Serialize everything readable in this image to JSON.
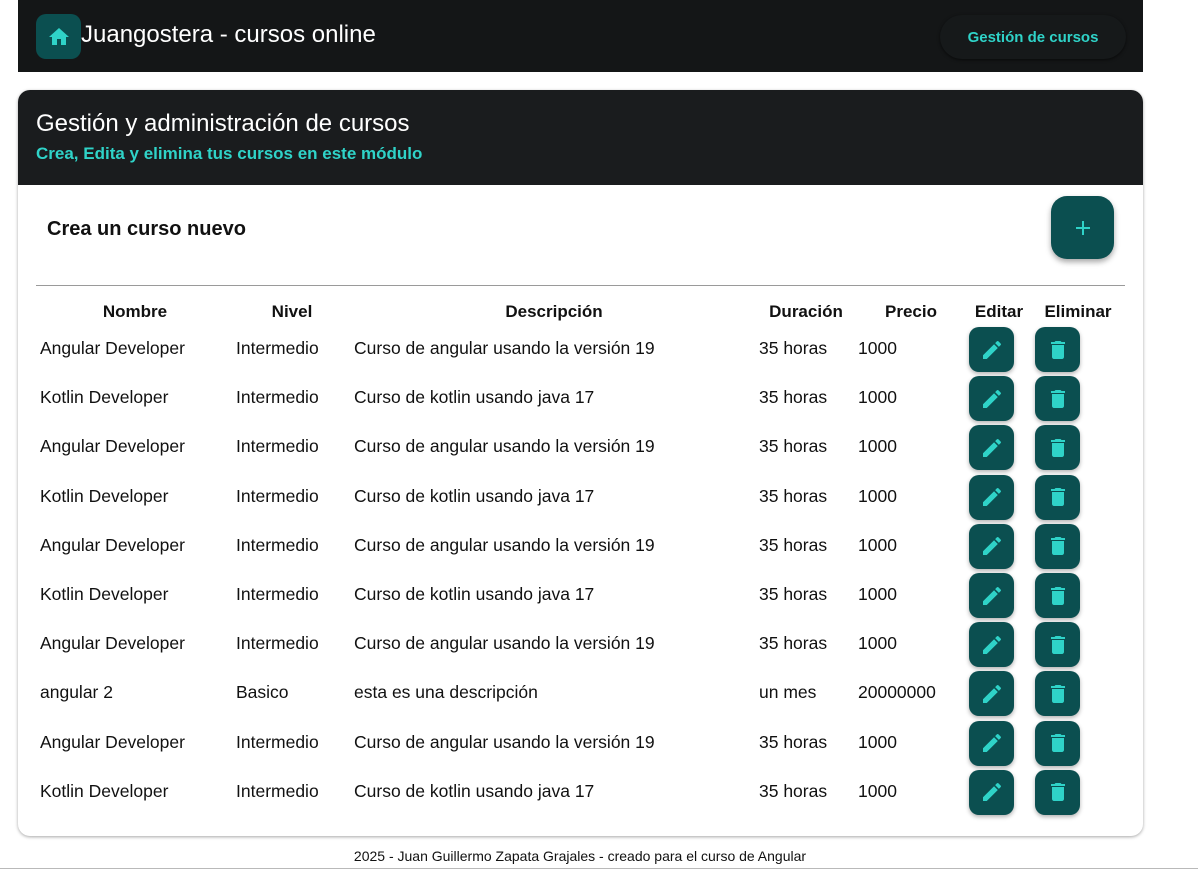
{
  "colors": {
    "topbar_bg": "#141617",
    "header_bg": "#1a1c1e",
    "accent": "#2fd3c8",
    "button_bg": "#0b4f50"
  },
  "navbar": {
    "home_icon": "home-icon",
    "title": "Juangostera - cursos online",
    "link_label": "Gestión de cursos"
  },
  "card": {
    "title": "Gestión y administración de cursos",
    "subtitle": "Crea, Edita y elimina tus cursos en este módulo",
    "create_label": "Crea un curso nuevo",
    "add_icon": "plus-icon"
  },
  "table": {
    "headers": {
      "name": "Nombre",
      "level": "Nivel",
      "description": "Descripción",
      "duration": "Duración",
      "price": "Precio",
      "edit": "Editar",
      "delete": "Eliminar"
    },
    "edit_icon": "pencil-icon",
    "delete_icon": "trash-icon",
    "rows": [
      {
        "name": "Angular Developer",
        "level": "Intermedio",
        "description": "Curso de angular usando la versión 19",
        "duration": "35 horas",
        "price": "1000"
      },
      {
        "name": "Kotlin Developer",
        "level": "Intermedio",
        "description": "Curso de kotlin usando java 17",
        "duration": "35 horas",
        "price": "1000"
      },
      {
        "name": "Angular Developer",
        "level": "Intermedio",
        "description": "Curso de angular usando la versión 19",
        "duration": "35 horas",
        "price": "1000"
      },
      {
        "name": "Kotlin Developer",
        "level": "Intermedio",
        "description": "Curso de kotlin usando java 17",
        "duration": "35 horas",
        "price": "1000"
      },
      {
        "name": "Angular Developer",
        "level": "Intermedio",
        "description": "Curso de angular usando la versión 19",
        "duration": "35 horas",
        "price": "1000"
      },
      {
        "name": "Kotlin Developer",
        "level": "Intermedio",
        "description": "Curso de kotlin usando java 17",
        "duration": "35 horas",
        "price": "1000"
      },
      {
        "name": "Angular Developer",
        "level": "Intermedio",
        "description": "Curso de angular usando la versión 19",
        "duration": "35 horas",
        "price": "1000"
      },
      {
        "name": "angular 2",
        "level": "Basico",
        "description": "esta es una descripción",
        "duration": "un mes",
        "price": "20000000"
      },
      {
        "name": "Angular Developer",
        "level": "Intermedio",
        "description": "Curso de angular usando la versión 19",
        "duration": "35 horas",
        "price": "1000"
      },
      {
        "name": "Kotlin Developer",
        "level": "Intermedio",
        "description": "Curso de kotlin usando java 17",
        "duration": "35 horas",
        "price": "1000"
      }
    ]
  },
  "footer": {
    "text": "2025 - Juan Guillermo Zapata Grajales - creado para el curso de Angular"
  }
}
